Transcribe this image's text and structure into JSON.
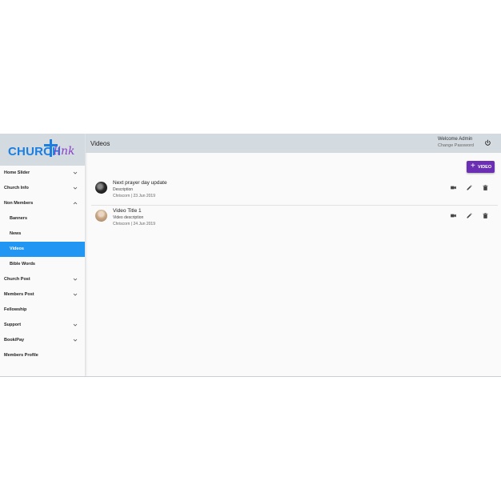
{
  "logo": {
    "word": "CHURCH",
    "script": "link"
  },
  "sidebar": {
    "items": [
      {
        "label": "Home Slider",
        "chevron": "down"
      },
      {
        "label": "Church Info",
        "chevron": "down"
      },
      {
        "label": "Non Members",
        "chevron": "up"
      },
      {
        "label": "Banners",
        "sub": true
      },
      {
        "label": "News",
        "sub": true
      },
      {
        "label": "Videos",
        "sub": true,
        "active": true
      },
      {
        "label": "Bible Words",
        "sub": true
      },
      {
        "label": "Church Post",
        "chevron": "down"
      },
      {
        "label": "Members Post",
        "chevron": "down"
      },
      {
        "label": "Fellowship"
      },
      {
        "label": "Support",
        "chevron": "down"
      },
      {
        "label": "Book/Pay",
        "chevron": "down"
      },
      {
        "label": "Members Profile"
      }
    ]
  },
  "header": {
    "title": "Videos",
    "welcome": "Welcome Admin",
    "change_password": "Change Password"
  },
  "add_button": {
    "label": "VIDEO"
  },
  "videos": [
    {
      "title": "Next prayer day update",
      "description": "Description",
      "meta": "Chriscorn | 23 Jun 2019"
    },
    {
      "title": "Video Title 1",
      "description": "Video description",
      "meta": "Chriscorn | 24 Jun 2019"
    }
  ],
  "colors": {
    "accent": "#2196f3",
    "add_button": "#6b2fb3",
    "header_bg": "#d3dbe1",
    "logo_blue": "#1a7fe0",
    "logo_purple": "#8a3fc7"
  },
  "icons": {
    "row_actions": [
      "video-camera-icon",
      "edit-pencil-icon",
      "delete-trash-icon"
    ],
    "header": "power-icon"
  }
}
